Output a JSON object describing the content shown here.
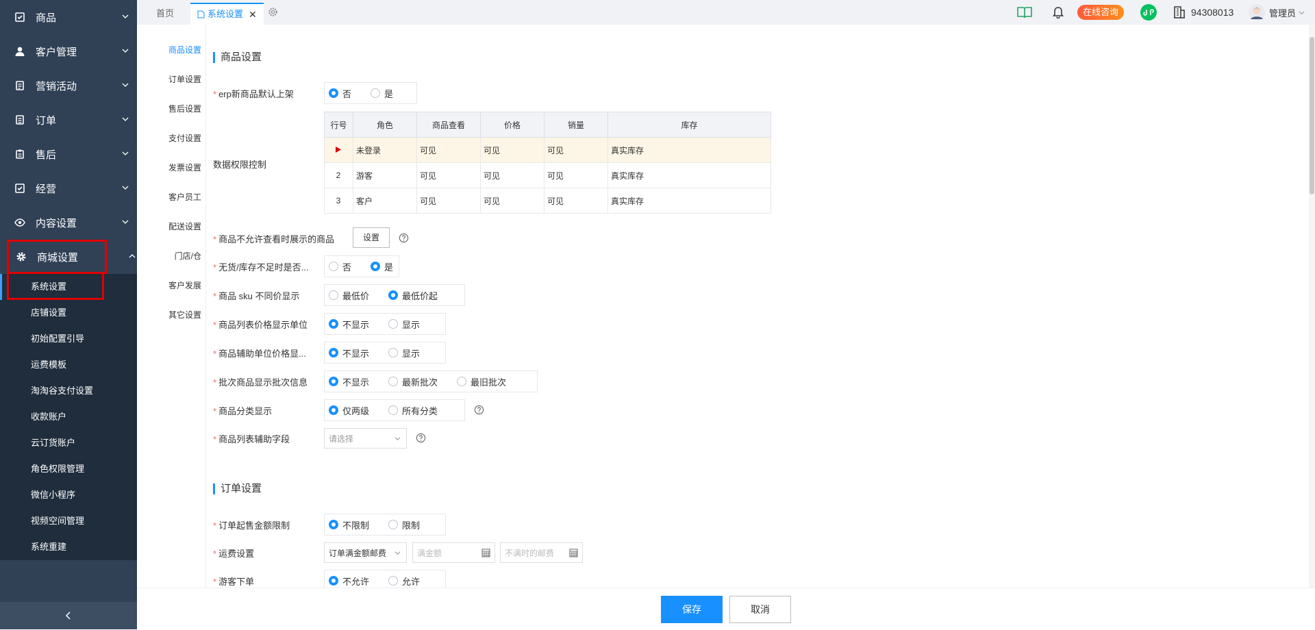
{
  "sidebar": {
    "menu": [
      {
        "label": "商品",
        "icon": "product-icon"
      },
      {
        "label": "客户管理",
        "icon": "user-icon"
      },
      {
        "label": "营销活动",
        "icon": "marketing-icon"
      },
      {
        "label": "订单",
        "icon": "order-icon"
      },
      {
        "label": "售后",
        "icon": "aftersale-icon"
      },
      {
        "label": "经营",
        "icon": "business-icon"
      },
      {
        "label": "内容设置",
        "icon": "eye-icon"
      },
      {
        "label": "商城设置",
        "icon": "gear-icon"
      }
    ],
    "submenu": [
      "系统设置",
      "店铺设置",
      "初始配置引导",
      "运费模板",
      "淘淘谷支付设置",
      "收款账户",
      "云订货账户",
      "角色权限管理",
      "微信小程序",
      "视频空间管理",
      "系统重建"
    ]
  },
  "topbar": {
    "tabs": {
      "home": "首页",
      "active": "系统设置"
    },
    "consult": "在线咨询",
    "company_id": "94308013",
    "user": "管理员"
  },
  "sidenav": [
    "商品设置",
    "订单设置",
    "售后设置",
    "支付设置",
    "发票设置",
    "客户员工",
    "配送设置",
    "门店/仓",
    "客户发展",
    "其它设置"
  ],
  "product_settings": {
    "title": "商品设置",
    "erp_default": {
      "label": "erp新商品默认上架",
      "options": [
        "否",
        "是"
      ],
      "selected": 0
    },
    "permission": {
      "label": "数据权限控制",
      "headers": [
        "行号",
        "角色",
        "商品查看",
        "价格",
        "销量",
        "库存"
      ],
      "rows": [
        {
          "no": "",
          "role": "未登录",
          "view": "可见",
          "price": "可见",
          "sales": "可见",
          "stock": "真实库存"
        },
        {
          "no": "2",
          "role": "游客",
          "view": "可见",
          "price": "可见",
          "sales": "可见",
          "stock": "真实库存"
        },
        {
          "no": "3",
          "role": "客户",
          "view": "可见",
          "price": "可见",
          "sales": "可见",
          "stock": "真实库存"
        }
      ]
    },
    "hidden_product": {
      "label": "商品不允许查看时展示的商品",
      "button": "设置"
    },
    "out_of_stock": {
      "label": "无货/库存不足时是否...",
      "options": [
        "否",
        "是"
      ],
      "selected": 1
    },
    "sku_price": {
      "label": "商品 sku 不同价显示",
      "options": [
        "最低价",
        "最低价起"
      ],
      "selected": 1
    },
    "list_unit": {
      "label": "商品列表价格显示单位",
      "options": [
        "不显示",
        "显示"
      ],
      "selected": 0
    },
    "aux_unit": {
      "label": "商品辅助单位价格显...",
      "options": [
        "不显示",
        "显示"
      ],
      "selected": 0
    },
    "batch_info": {
      "label": "批次商品显示批次信息",
      "options": [
        "不显示",
        "最新批次",
        "最旧批次"
      ],
      "selected": 0
    },
    "category": {
      "label": "商品分类显示",
      "options": [
        "仅两级",
        "所有分类"
      ],
      "selected": 0
    },
    "aux_field": {
      "label": "商品列表辅助字段",
      "placeholder": "请选择"
    }
  },
  "order_settings": {
    "title": "订单设置",
    "min_amount": {
      "label": "订单起售金额限制",
      "options": [
        "不限制",
        "限制"
      ],
      "selected": 0
    },
    "shipping": {
      "label": "运费设置",
      "select": "订单满金额邮费",
      "full_amount_ph": "满金额",
      "fee_ph": "不满时的邮费"
    },
    "guest_order": {
      "label": "游客下单",
      "options": [
        "不允许",
        "允许"
      ],
      "selected": 0
    }
  },
  "footer": {
    "save": "保存",
    "cancel": "取消"
  }
}
